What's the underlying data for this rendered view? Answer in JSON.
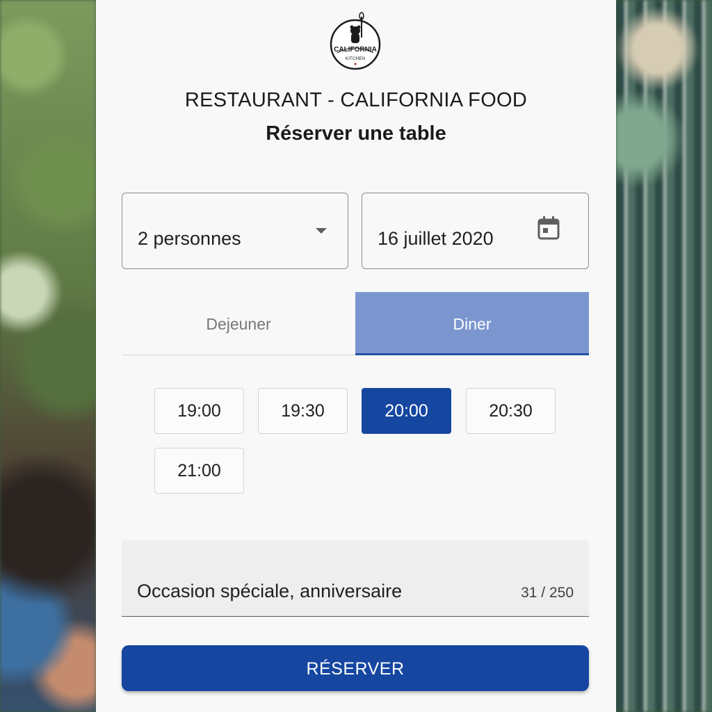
{
  "logo": {
    "line1": "CALIFORNIA",
    "line2": "KITCHEN",
    "icon": "bear-logo-icon"
  },
  "header": {
    "title": "RESTAURANT - CALIFORNIA FOOD",
    "subtitle": "Réserver une table"
  },
  "form": {
    "party_size": {
      "value": "2 personnes",
      "icon": "chevron-down-icon"
    },
    "date": {
      "value": "16 juillet 2020",
      "icon": "calendar-icon"
    }
  },
  "service_tabs": [
    {
      "label": "Dejeuner",
      "selected": false
    },
    {
      "label": "Diner",
      "selected": true
    }
  ],
  "time_slots": [
    {
      "label": "19:00",
      "selected": false
    },
    {
      "label": "19:30",
      "selected": false
    },
    {
      "label": "20:00",
      "selected": true
    },
    {
      "label": "20:30",
      "selected": false
    },
    {
      "label": "21:00",
      "selected": false
    }
  ],
  "note": {
    "value": "Occasion spéciale, anniversaire",
    "counter": "31 / 250"
  },
  "submit_label": "RÉSERVER",
  "colors": {
    "primary": "#1546a0",
    "tab_selected": "#7b96cf",
    "card": "#f8f8f8"
  }
}
